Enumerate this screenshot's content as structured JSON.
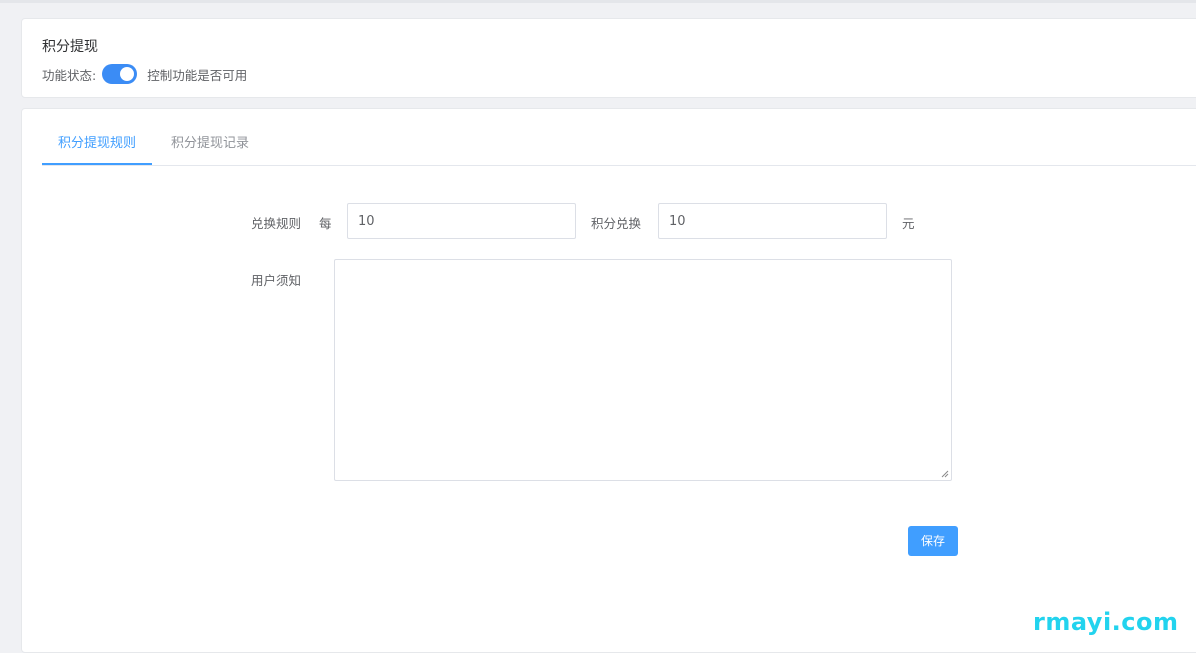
{
  "header": {
    "title": "积分提现",
    "status_label": "功能状态:",
    "status_enabled": true,
    "status_hint": "控制功能是否可用"
  },
  "tabs": [
    {
      "label": "积分提现规则",
      "active": true
    },
    {
      "label": "积分提现记录",
      "active": false
    }
  ],
  "form": {
    "exchange_rule_label": "兑换规则",
    "per_label": "每",
    "points_value": "10",
    "points_exchange_label": "积分兑换",
    "yuan_value": "10",
    "yuan_label": "元",
    "notice_label": "用户须知",
    "notice_value": "",
    "save_label": "保存"
  },
  "watermark": "rmayi.com",
  "colors": {
    "accent": "#409eff",
    "toggle_on": "#3b8cf5",
    "watermark": "#22d3ee"
  }
}
